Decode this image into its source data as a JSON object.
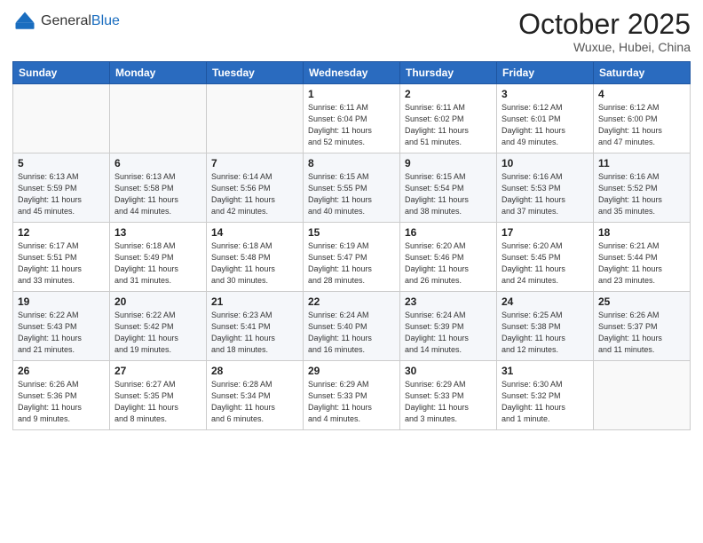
{
  "header": {
    "logo_general": "General",
    "logo_blue": "Blue",
    "month_title": "October 2025",
    "subtitle": "Wuxue, Hubei, China"
  },
  "weekdays": [
    "Sunday",
    "Monday",
    "Tuesday",
    "Wednesday",
    "Thursday",
    "Friday",
    "Saturday"
  ],
  "weeks": [
    [
      {
        "day": "",
        "info": ""
      },
      {
        "day": "",
        "info": ""
      },
      {
        "day": "",
        "info": ""
      },
      {
        "day": "1",
        "info": "Sunrise: 6:11 AM\nSunset: 6:04 PM\nDaylight: 11 hours\nand 52 minutes."
      },
      {
        "day": "2",
        "info": "Sunrise: 6:11 AM\nSunset: 6:02 PM\nDaylight: 11 hours\nand 51 minutes."
      },
      {
        "day": "3",
        "info": "Sunrise: 6:12 AM\nSunset: 6:01 PM\nDaylight: 11 hours\nand 49 minutes."
      },
      {
        "day": "4",
        "info": "Sunrise: 6:12 AM\nSunset: 6:00 PM\nDaylight: 11 hours\nand 47 minutes."
      }
    ],
    [
      {
        "day": "5",
        "info": "Sunrise: 6:13 AM\nSunset: 5:59 PM\nDaylight: 11 hours\nand 45 minutes."
      },
      {
        "day": "6",
        "info": "Sunrise: 6:13 AM\nSunset: 5:58 PM\nDaylight: 11 hours\nand 44 minutes."
      },
      {
        "day": "7",
        "info": "Sunrise: 6:14 AM\nSunset: 5:56 PM\nDaylight: 11 hours\nand 42 minutes."
      },
      {
        "day": "8",
        "info": "Sunrise: 6:15 AM\nSunset: 5:55 PM\nDaylight: 11 hours\nand 40 minutes."
      },
      {
        "day": "9",
        "info": "Sunrise: 6:15 AM\nSunset: 5:54 PM\nDaylight: 11 hours\nand 38 minutes."
      },
      {
        "day": "10",
        "info": "Sunrise: 6:16 AM\nSunset: 5:53 PM\nDaylight: 11 hours\nand 37 minutes."
      },
      {
        "day": "11",
        "info": "Sunrise: 6:16 AM\nSunset: 5:52 PM\nDaylight: 11 hours\nand 35 minutes."
      }
    ],
    [
      {
        "day": "12",
        "info": "Sunrise: 6:17 AM\nSunset: 5:51 PM\nDaylight: 11 hours\nand 33 minutes."
      },
      {
        "day": "13",
        "info": "Sunrise: 6:18 AM\nSunset: 5:49 PM\nDaylight: 11 hours\nand 31 minutes."
      },
      {
        "day": "14",
        "info": "Sunrise: 6:18 AM\nSunset: 5:48 PM\nDaylight: 11 hours\nand 30 minutes."
      },
      {
        "day": "15",
        "info": "Sunrise: 6:19 AM\nSunset: 5:47 PM\nDaylight: 11 hours\nand 28 minutes."
      },
      {
        "day": "16",
        "info": "Sunrise: 6:20 AM\nSunset: 5:46 PM\nDaylight: 11 hours\nand 26 minutes."
      },
      {
        "day": "17",
        "info": "Sunrise: 6:20 AM\nSunset: 5:45 PM\nDaylight: 11 hours\nand 24 minutes."
      },
      {
        "day": "18",
        "info": "Sunrise: 6:21 AM\nSunset: 5:44 PM\nDaylight: 11 hours\nand 23 minutes."
      }
    ],
    [
      {
        "day": "19",
        "info": "Sunrise: 6:22 AM\nSunset: 5:43 PM\nDaylight: 11 hours\nand 21 minutes."
      },
      {
        "day": "20",
        "info": "Sunrise: 6:22 AM\nSunset: 5:42 PM\nDaylight: 11 hours\nand 19 minutes."
      },
      {
        "day": "21",
        "info": "Sunrise: 6:23 AM\nSunset: 5:41 PM\nDaylight: 11 hours\nand 18 minutes."
      },
      {
        "day": "22",
        "info": "Sunrise: 6:24 AM\nSunset: 5:40 PM\nDaylight: 11 hours\nand 16 minutes."
      },
      {
        "day": "23",
        "info": "Sunrise: 6:24 AM\nSunset: 5:39 PM\nDaylight: 11 hours\nand 14 minutes."
      },
      {
        "day": "24",
        "info": "Sunrise: 6:25 AM\nSunset: 5:38 PM\nDaylight: 11 hours\nand 12 minutes."
      },
      {
        "day": "25",
        "info": "Sunrise: 6:26 AM\nSunset: 5:37 PM\nDaylight: 11 hours\nand 11 minutes."
      }
    ],
    [
      {
        "day": "26",
        "info": "Sunrise: 6:26 AM\nSunset: 5:36 PM\nDaylight: 11 hours\nand 9 minutes."
      },
      {
        "day": "27",
        "info": "Sunrise: 6:27 AM\nSunset: 5:35 PM\nDaylight: 11 hours\nand 8 minutes."
      },
      {
        "day": "28",
        "info": "Sunrise: 6:28 AM\nSunset: 5:34 PM\nDaylight: 11 hours\nand 6 minutes."
      },
      {
        "day": "29",
        "info": "Sunrise: 6:29 AM\nSunset: 5:33 PM\nDaylight: 11 hours\nand 4 minutes."
      },
      {
        "day": "30",
        "info": "Sunrise: 6:29 AM\nSunset: 5:33 PM\nDaylight: 11 hours\nand 3 minutes."
      },
      {
        "day": "31",
        "info": "Sunrise: 6:30 AM\nSunset: 5:32 PM\nDaylight: 11 hours\nand 1 minute."
      },
      {
        "day": "",
        "info": ""
      }
    ]
  ]
}
